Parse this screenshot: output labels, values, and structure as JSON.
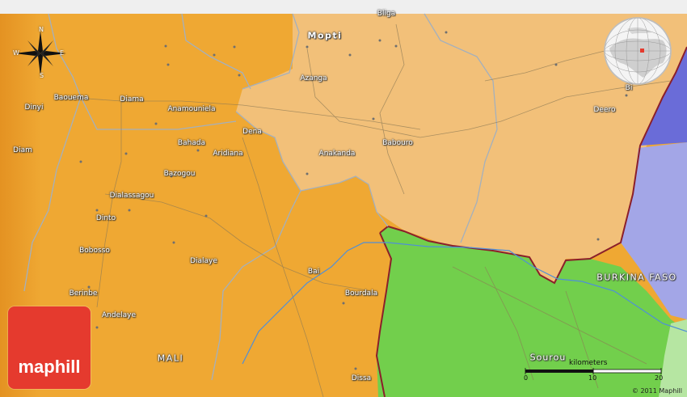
{
  "colors": {
    "top_bar": "#efefef",
    "mali_dark_orange": "#efa830",
    "region_light_tan": "#f3c279",
    "burkina_green": "#6fcf4a",
    "water_blue": "#6b6dd8",
    "lavender": "#a0a3e6",
    "border_maroon": "#8b1f2a",
    "road_gray": "#a3b0bd",
    "logo_red": "#e53a2e"
  },
  "compass": {
    "n": "N",
    "s": "S",
    "e": "E",
    "w": "W"
  },
  "places": {
    "bliga": "Bliga",
    "mopti": "Mopti",
    "azanga": "Azanga",
    "bi": "Bi",
    "deero": "Deero",
    "dinyi": "Dinyi",
    "baouema": "Baouema",
    "diama": "Diama",
    "anamouniela": "Anamouniela",
    "dena": "Dena",
    "babouro": "Babouro",
    "diam": "Diam",
    "bahada": "Bahada",
    "aridiana": "Aridiana",
    "anakanda": "Anakanda",
    "bazogou": "Bazogou",
    "dialassagou": "Dialassagou",
    "dinto": "Dinto",
    "bobosso": "Bobosso",
    "dialaye": "Dialaye",
    "bai": "Bai",
    "bourdala": "Bourdala",
    "berinbe": "Berinbe",
    "andelaye": "Andelaye",
    "dissa": "Dissa"
  },
  "countries": {
    "mali": "MALI",
    "burkina": "BURKINA FASO"
  },
  "river": {
    "sourou": "Sourou"
  },
  "logo": {
    "text": "maphill"
  },
  "scale": {
    "title": "kilometers",
    "t0": "0",
    "t1": "10",
    "t2": "20"
  },
  "copyright": "© 2011 Maphill"
}
